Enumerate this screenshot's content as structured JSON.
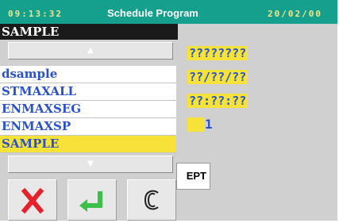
{
  "header": {
    "time": "09:13:32",
    "title": "Schedule Program",
    "date": "20/02/00"
  },
  "program_list": {
    "title": "SAMPLE",
    "items": [
      {
        "label": "dsample",
        "selected": false
      },
      {
        "label": "STMAXALL",
        "selected": false
      },
      {
        "label": "ENMAXSEG",
        "selected": false
      },
      {
        "label": "ENMAXSP",
        "selected": false
      },
      {
        "label": "SAMPLE",
        "selected": true
      }
    ]
  },
  "fields": {
    "name": "????????",
    "date": "??/??/??",
    "time": "??:??:??",
    "segment": "1"
  },
  "buttons": {
    "partial_label": "EPT"
  },
  "icons": {
    "up": "up-arrow-icon",
    "down": "down-arrow-icon",
    "cancel": "red-cross-icon",
    "enter": "enter-arrow-icon",
    "clear": "clear-c-icon"
  },
  "colors": {
    "header": "#14a08c",
    "highlight": "#f7e23a",
    "text": "#2a52c8",
    "cancel": "#e8202a",
    "enter": "#3cc04a"
  }
}
